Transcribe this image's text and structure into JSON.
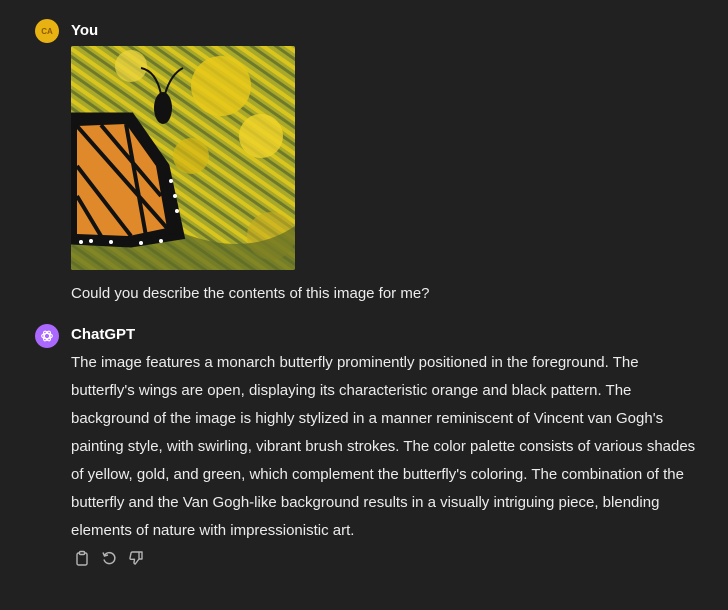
{
  "user": {
    "avatar_initials": "CA",
    "name": "You",
    "message": "Could you describe the contents of this image for me?"
  },
  "assistant": {
    "name": "ChatGPT",
    "response": "The image features a monarch butterfly prominently positioned in the foreground. The butterfly's wings are open, displaying its characteristic orange and black pattern. The background of the image is highly stylized in a manner reminiscent of Vincent van Gogh's painting style, with swirling, vibrant brush strokes. The color palette consists of various shades of yellow, gold, and green, which complement the butterfly's coloring. The combination of the butterfly and the Van Gogh-like background results in a visually intriguing piece, blending elements of nature with impressionistic art."
  },
  "icons": {
    "copy": "clipboard-icon",
    "regenerate": "regenerate-icon",
    "dislike": "thumbs-down-icon",
    "assistant_logo": "openai-logo-icon"
  },
  "colors": {
    "background": "#212121",
    "user_avatar": "#e9b213",
    "assistant_avatar": "#ab68ff",
    "text": "#ececec"
  }
}
